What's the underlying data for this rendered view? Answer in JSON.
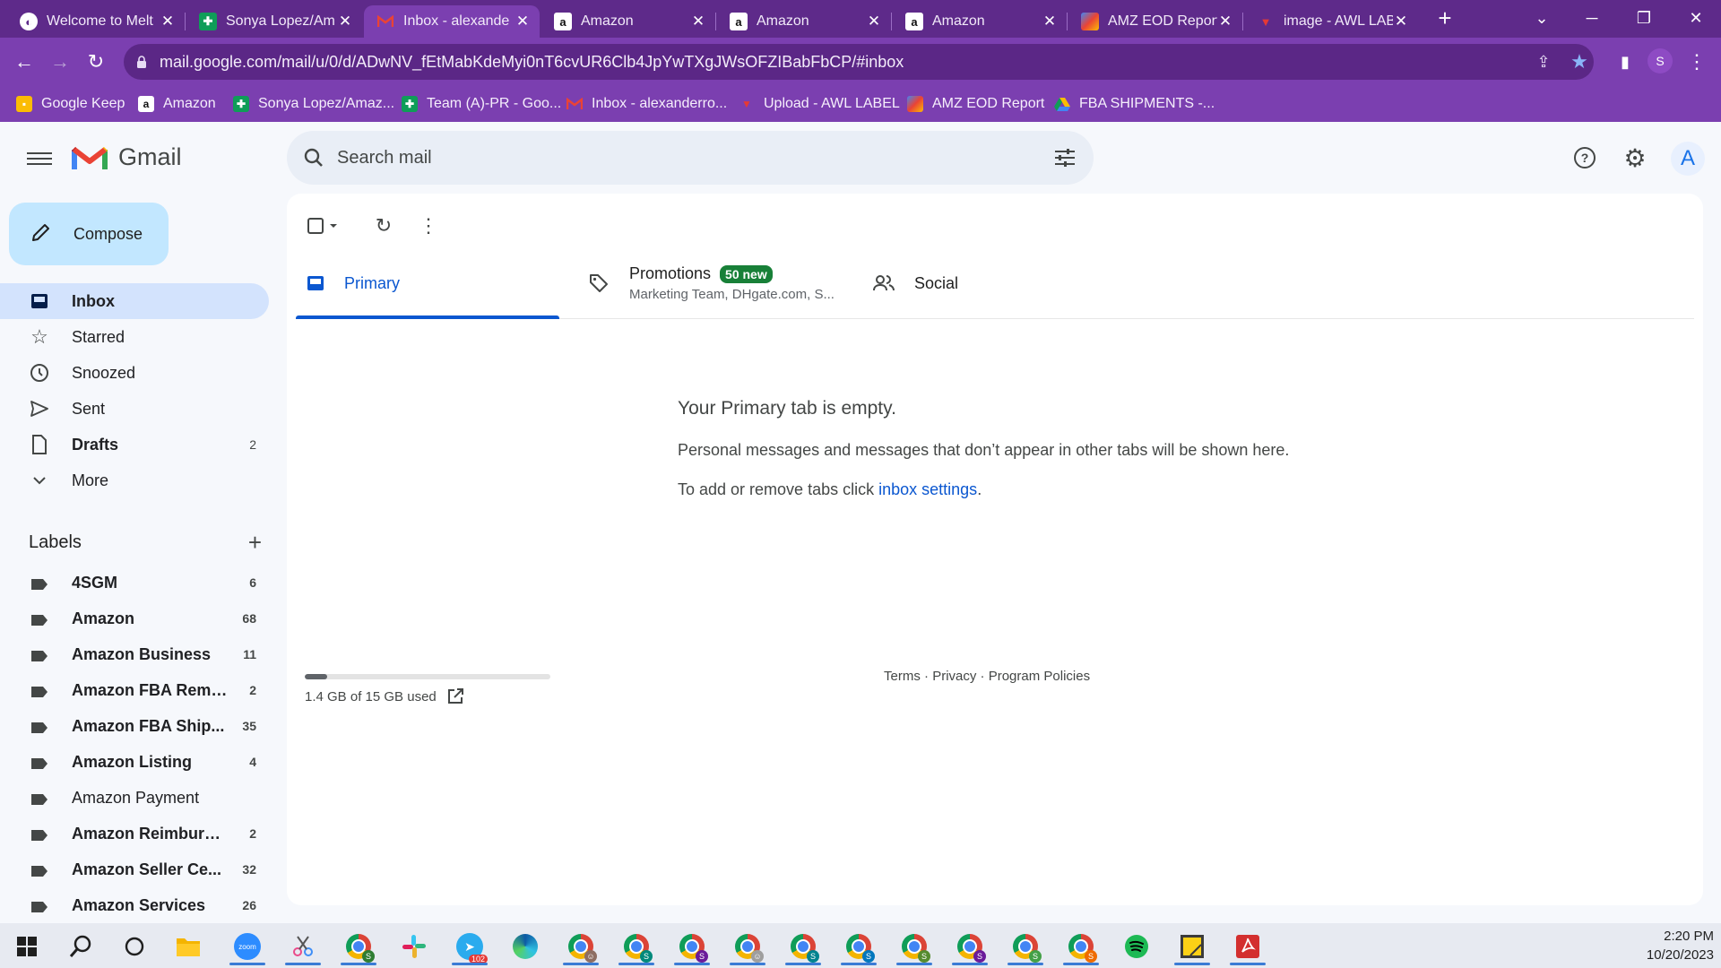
{
  "browser": {
    "tabs": [
      {
        "title": "Welcome to Melt",
        "favicon": "melt-icon"
      },
      {
        "title": "Sonya Lopez/Am",
        "favicon": "sheets-icon"
      },
      {
        "title": "Inbox - alexande",
        "favicon": "gmail-icon",
        "active": true
      },
      {
        "title": "Amazon",
        "favicon": "amazon-icon"
      },
      {
        "title": "Amazon",
        "favicon": "amazon-icon"
      },
      {
        "title": "Amazon",
        "favicon": "amazon-icon"
      },
      {
        "title": "AMZ EOD Report",
        "favicon": "report-icon"
      },
      {
        "title": "image - AWL LAB",
        "favicon": "awl-icon"
      }
    ],
    "url": "mail.google.com/mail/u/0/d/ADwNV_fEtMabKdeMyi0nT6cvUR6Clb4JpYwTXgJWsOFZIBabFbCP/#inbox",
    "profile_initial": "S",
    "bookmarks": [
      {
        "label": "Google Keep",
        "icon": "keep-icon"
      },
      {
        "label": "Amazon",
        "icon": "amazon-icon"
      },
      {
        "label": "Sonya Lopez/Amaz...",
        "icon": "sheets-icon"
      },
      {
        "label": "Team (A)-PR - Goo...",
        "icon": "sheets-icon"
      },
      {
        "label": "Inbox - alexanderro...",
        "icon": "gmail-icon"
      },
      {
        "label": "Upload - AWL LABEL",
        "icon": "awl-icon"
      },
      {
        "label": "AMZ EOD Report",
        "icon": "report-icon"
      },
      {
        "label": "FBA SHIPMENTS -...",
        "icon": "drive-icon"
      }
    ],
    "colors": {
      "frame": "#5e2a8a",
      "toolbar": "#7b3fb0"
    }
  },
  "gmail": {
    "logo_text": "Gmail",
    "search_placeholder": "Search mail",
    "account_initial": "A",
    "compose_label": "Compose",
    "nav": [
      {
        "label": "Inbox",
        "count": "",
        "icon": "inbox-icon",
        "active": true
      },
      {
        "label": "Starred",
        "count": "",
        "icon": "star-icon"
      },
      {
        "label": "Snoozed",
        "count": "",
        "icon": "clock-icon"
      },
      {
        "label": "Sent",
        "count": "",
        "icon": "send-icon"
      },
      {
        "label": "Drafts",
        "count": "2",
        "icon": "draft-icon"
      },
      {
        "label": "More",
        "count": "",
        "icon": "chevron-down-icon"
      }
    ],
    "labels_title": "Labels",
    "labels": [
      {
        "label": "4SGM",
        "count": "6",
        "bold": true
      },
      {
        "label": "Amazon",
        "count": "68",
        "bold": true
      },
      {
        "label": "Amazon Business",
        "count": "11",
        "bold": true
      },
      {
        "label": "Amazon FBA Remo...",
        "count": "2",
        "bold": true
      },
      {
        "label": "Amazon FBA Ship...",
        "count": "35",
        "bold": true
      },
      {
        "label": "Amazon Listing",
        "count": "4",
        "bold": true
      },
      {
        "label": "Amazon Payment",
        "count": "",
        "bold": false
      },
      {
        "label": "Amazon Reimburse...",
        "count": "2",
        "bold": true
      },
      {
        "label": "Amazon Seller Ce...",
        "count": "32",
        "bold": true
      },
      {
        "label": "Amazon Services",
        "count": "26",
        "bold": true
      }
    ],
    "category_tabs": [
      {
        "label": "Primary",
        "icon": "inbox-icon",
        "active": true
      },
      {
        "label": "Promotions",
        "badge": "50 new",
        "snippet": "Marketing Team, DHgate.com, S...",
        "icon": "tag-icon"
      },
      {
        "label": "Social",
        "icon": "people-icon"
      }
    ],
    "empty": {
      "title": "Your Primary tab is empty.",
      "line1": "Personal messages and messages that don’t appear in other tabs will be shown here.",
      "line2_prefix": "To add or remove tabs click ",
      "line2_link": "inbox settings",
      "line2_suffix": "."
    },
    "storage": {
      "text": "1.4 GB of 15 GB used",
      "used_fraction": 0.093
    },
    "footer": {
      "terms": "Terms",
      "privacy": "Privacy",
      "policies": "Program Policies",
      "sep": " · "
    }
  },
  "taskbar": {
    "apps": [
      "start-icon",
      "search-icon",
      "task-view-icon",
      "file-explorer-icon",
      "zoom-icon",
      "snip-icon",
      "chrome-icon",
      "slack-icon",
      "telegram-icon",
      "edge-icon",
      "chrome-icon",
      "chrome-icon",
      "chrome-icon",
      "chrome-icon",
      "chrome-icon",
      "chrome-icon",
      "chrome-icon",
      "chrome-icon",
      "chrome-icon",
      "chrome-icon",
      "spotify-icon",
      "sticky-notes-icon",
      "acrobat-icon"
    ],
    "telegram_badge": "102",
    "time": "2:20 PM",
    "date": "10/20/2023"
  }
}
